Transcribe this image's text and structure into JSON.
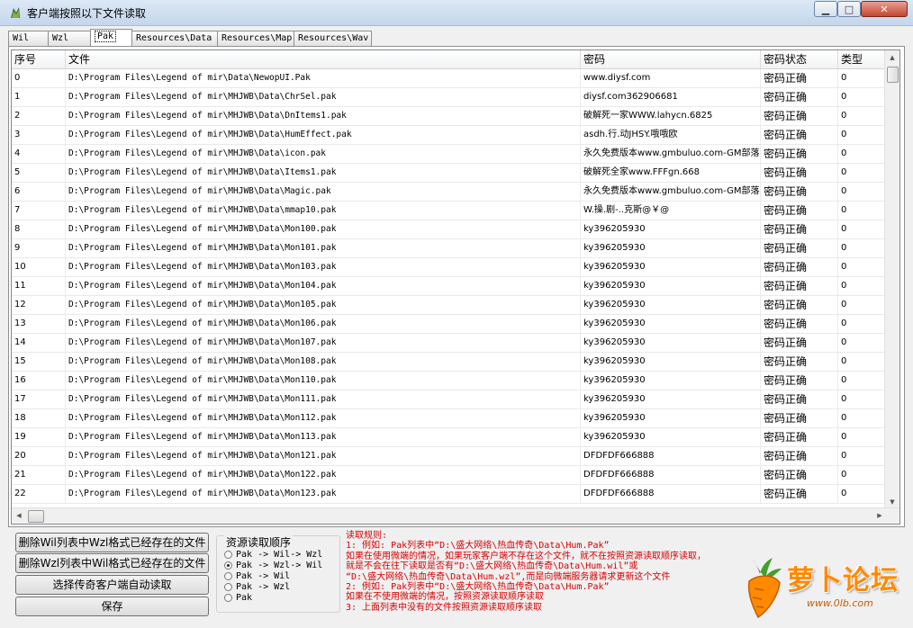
{
  "window": {
    "title": "客户端按照以下文件读取"
  },
  "tabs": [
    "Wil",
    "Wzl",
    "Pak",
    "Resources\\Data",
    "Resources\\Map",
    "Resources\\Wav"
  ],
  "active_tab": 2,
  "columns": [
    "序号",
    "文件",
    "密码",
    "密码状态",
    "类型"
  ],
  "rows": [
    [
      "0",
      "D:\\Program Files\\Legend of mir\\Data\\NewopUI.Pak",
      "www.diysf.com",
      "密码正确",
      "0"
    ],
    [
      "1",
      "D:\\Program Files\\Legend of mir\\MHJWB\\Data\\ChrSel.pak",
      "diysf.com362906681",
      "密码正确",
      "0"
    ],
    [
      "2",
      "D:\\Program Files\\Legend of mir\\MHJWB\\Data\\DnItems1.pak",
      "破解死一家WWW.lahycn.6825",
      "密码正确",
      "0"
    ],
    [
      "3",
      "D:\\Program Files\\Legend of mir\\MHJWB\\Data\\HumEffect.pak",
      "asdh.行.动JHSY.哦哦欧",
      "密码正确",
      "0"
    ],
    [
      "4",
      "D:\\Program Files\\Legend of mir\\MHJWB\\Data\\icon.pak",
      "永久免费版本www.gmbuluo.com-GM部落",
      "密码正确",
      "0"
    ],
    [
      "5",
      "D:\\Program Files\\Legend of mir\\MHJWB\\Data\\Items1.pak",
      "破解死全家www.FFFgn.668",
      "密码正确",
      "0"
    ],
    [
      "6",
      "D:\\Program Files\\Legend of mir\\MHJWB\\Data\\Magic.pak",
      "永久免费版本www.gmbuluo.com-GM部落",
      "密码正确",
      "0"
    ],
    [
      "7",
      "D:\\Program Files\\Legend of mir\\MHJWB\\Data\\mmap10.pak",
      "W.操.剧-..克斯@￥@",
      "密码正确",
      "0"
    ],
    [
      "8",
      "D:\\Program Files\\Legend of mir\\MHJWB\\Data\\Mon100.pak",
      "ky396205930",
      "密码正确",
      "0"
    ],
    [
      "9",
      "D:\\Program Files\\Legend of mir\\MHJWB\\Data\\Mon101.pak",
      "ky396205930",
      "密码正确",
      "0"
    ],
    [
      "10",
      "D:\\Program Files\\Legend of mir\\MHJWB\\Data\\Mon103.pak",
      "ky396205930",
      "密码正确",
      "0"
    ],
    [
      "11",
      "D:\\Program Files\\Legend of mir\\MHJWB\\Data\\Mon104.pak",
      "ky396205930",
      "密码正确",
      "0"
    ],
    [
      "12",
      "D:\\Program Files\\Legend of mir\\MHJWB\\Data\\Mon105.pak",
      "ky396205930",
      "密码正确",
      "0"
    ],
    [
      "13",
      "D:\\Program Files\\Legend of mir\\MHJWB\\Data\\Mon106.pak",
      "ky396205930",
      "密码正确",
      "0"
    ],
    [
      "14",
      "D:\\Program Files\\Legend of mir\\MHJWB\\Data\\Mon107.pak",
      "ky396205930",
      "密码正确",
      "0"
    ],
    [
      "15",
      "D:\\Program Files\\Legend of mir\\MHJWB\\Data\\Mon108.pak",
      "ky396205930",
      "密码正确",
      "0"
    ],
    [
      "16",
      "D:\\Program Files\\Legend of mir\\MHJWB\\Data\\Mon110.pak",
      "ky396205930",
      "密码正确",
      "0"
    ],
    [
      "17",
      "D:\\Program Files\\Legend of mir\\MHJWB\\Data\\Mon111.pak",
      "ky396205930",
      "密码正确",
      "0"
    ],
    [
      "18",
      "D:\\Program Files\\Legend of mir\\MHJWB\\Data\\Mon112.pak",
      "ky396205930",
      "密码正确",
      "0"
    ],
    [
      "19",
      "D:\\Program Files\\Legend of mir\\MHJWB\\Data\\Mon113.pak",
      "ky396205930",
      "密码正确",
      "0"
    ],
    [
      "20",
      "D:\\Program Files\\Legend of mir\\MHJWB\\Data\\Mon121.pak",
      "DFDFDF666888",
      "密码正确",
      "0"
    ],
    [
      "21",
      "D:\\Program Files\\Legend of mir\\MHJWB\\Data\\Mon122.pak",
      "DFDFDF666888",
      "密码正确",
      "0"
    ],
    [
      "22",
      "D:\\Program Files\\Legend of mir\\MHJWB\\Data\\Mon123.pak",
      "DFDFDF666888",
      "密码正确",
      "0"
    ]
  ],
  "buttons": {
    "delete_wil": "删除Wil列表中Wzl格式已经存在的文件",
    "delete_wzl": "删除Wzl列表中Wil格式已经存在的文件",
    "auto_read": "选择传奇客户端自动读取",
    "save": "保存"
  },
  "read_order": {
    "title": "资源读取顺序",
    "options": [
      "Pak -> Wil-> Wzl",
      "Pak -> Wzl-> Wil",
      "Pak -> Wil",
      "Pak -> Wzl",
      "Pak"
    ],
    "selected": 1
  },
  "rules": [
    "读取规则:",
    "1: 例如: Pak列表中“D:\\盛大网络\\热血传奇\\Data\\Hum.Pak”",
    "    如果在使用微端的情况，如果玩家客户端不存在这个文件，就不在按照资源读取顺序读取，",
    "    就是不会在往下读取是否有“D:\\盛大网络\\热血传奇\\Data\\Hum.wil”或",
    "    “D:\\盛大网络\\热血传奇\\Data\\Hum.wzl”,而是向微端服务器请求更新这个文件",
    "2: 例如: Pak列表中“D:\\盛大网络\\热血传奇\\Data\\Hum.Pak”",
    "    如果在不使用微端的情况，按照资源读取顺序读取",
    "3: 上面列表中没有的文件按照资源读取顺序读取"
  ],
  "watermark": {
    "text": "萝卜论坛",
    "url": "www.0lb.com"
  },
  "colors": {
    "rules_text": "#d40000",
    "logo_orange": "#ff8a00"
  }
}
